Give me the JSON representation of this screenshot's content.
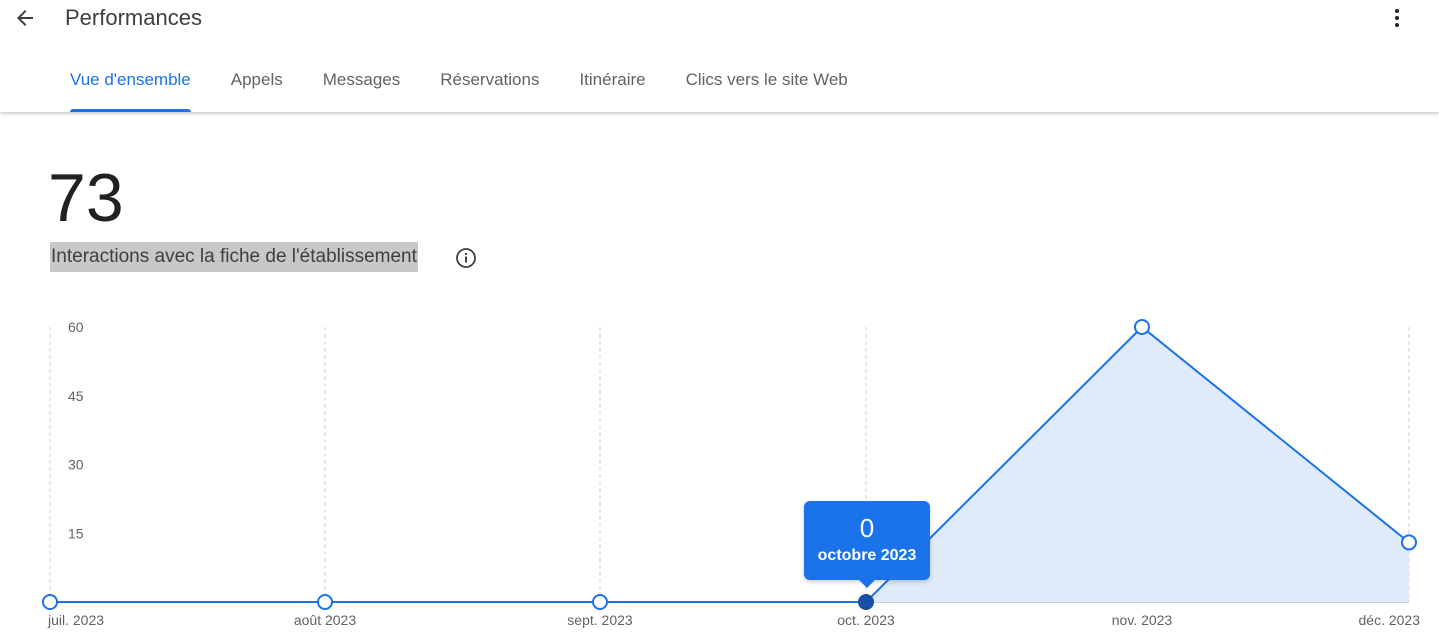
{
  "header": {
    "title": "Performances",
    "tabs": [
      {
        "label": "Vue d'ensemble",
        "active": true
      },
      {
        "label": "Appels",
        "active": false
      },
      {
        "label": "Messages",
        "active": false
      },
      {
        "label": "Réservations",
        "active": false
      },
      {
        "label": "Itinéraire",
        "active": false
      },
      {
        "label": "Clics vers le site Web",
        "active": false
      }
    ]
  },
  "icons": {
    "back": "arrow-back-icon",
    "more": "more-vert-icon",
    "info": "info-icon"
  },
  "metric": {
    "value": "73",
    "label": "Interactions avec la fiche de l'établissement"
  },
  "tooltip": {
    "value": "0",
    "label": "octobre 2023"
  },
  "colors": {
    "accent": "#1a73e8",
    "selected_point": "#174ea6",
    "area_fill": "#dfeafb",
    "label_highlight": "#c8c8c8"
  },
  "chart_data": {
    "type": "area",
    "categories": [
      "juil. 2023",
      "août 2023",
      "sept. 2023",
      "oct. 2023",
      "nov. 2023",
      "déc. 2023"
    ],
    "values": [
      0,
      0,
      0,
      0,
      60,
      13
    ],
    "yticks": [
      15,
      30,
      45,
      60
    ],
    "ylim": [
      0,
      60
    ],
    "selected_index": 3,
    "grid": "vertical-dashed"
  }
}
